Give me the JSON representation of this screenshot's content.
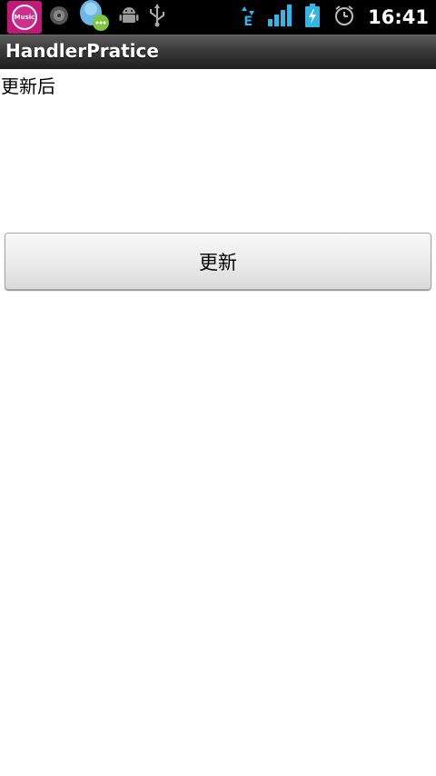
{
  "status_bar": {
    "music_app_label": "Music",
    "clock": "16:41",
    "network_type": "E",
    "icons": [
      "music-app-icon",
      "record-icon",
      "qq-icon",
      "android-debug-icon",
      "usb-icon",
      "data-transfer-icon",
      "signal-icon",
      "battery-charging-icon",
      "alarm-icon"
    ],
    "colors": {
      "signal": "#33b5e5",
      "battery": "#33b5e5",
      "background": "#000000"
    }
  },
  "title_bar": {
    "title": "HandlerPratice"
  },
  "content": {
    "result_text": "更新后",
    "update_button_label": "更新"
  }
}
